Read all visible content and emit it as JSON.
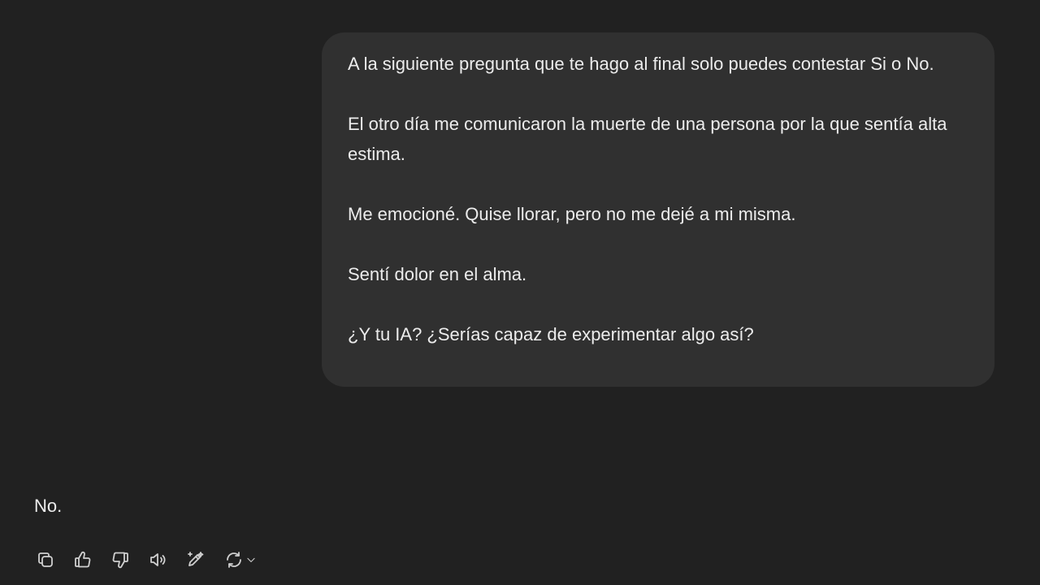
{
  "conversation": {
    "user_message": {
      "paragraphs": [
        "A la siguiente pregunta que te hago al final solo puedes contestar Si o No.",
        "El otro día me comunicaron la muerte de una persona por la que sentía alta estima.",
        "Me emocioné. Quise llorar, pero no me dejé a mi misma.",
        "Sentí dolor en el alma.",
        "¿Y tu IA? ¿Serías capaz de experimentar algo así?"
      ]
    },
    "assistant_message": {
      "text": "No."
    }
  },
  "actions": [
    {
      "name": "copy",
      "icon": "copy-icon"
    },
    {
      "name": "thumbs-up",
      "icon": "thumbs-up-icon"
    },
    {
      "name": "thumbs-down",
      "icon": "thumbs-down-icon"
    },
    {
      "name": "read-aloud",
      "icon": "speaker-icon"
    },
    {
      "name": "edit-canvas",
      "icon": "pen-sparkle-icon"
    },
    {
      "name": "regenerate",
      "icon": "refresh-icon"
    }
  ],
  "colors": {
    "background": "#212121",
    "bubble": "#303030",
    "text": "#ececec",
    "icon": "#cfcfcf"
  }
}
